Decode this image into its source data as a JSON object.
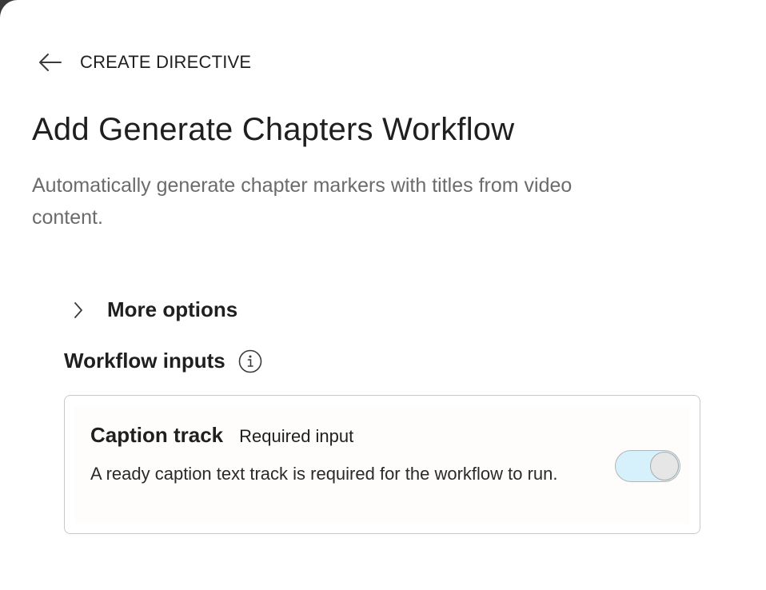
{
  "header": {
    "back_icon": "arrow-left-icon",
    "breadcrumb": "CREATE DIRECTIVE"
  },
  "page": {
    "title": "Add Generate Chapters Workflow",
    "subtitle": "Automatically generate chapter markers with titles from video content."
  },
  "more_options": {
    "icon": "chevron-right-icon",
    "label": "More options"
  },
  "workflow_inputs": {
    "label": "Workflow inputs",
    "info_icon": "info-icon",
    "items": [
      {
        "title": "Caption track",
        "badge": "Required input",
        "description": "A ready caption text track is required for the workflow to run.",
        "toggle_on": true
      }
    ]
  },
  "colors": {
    "toggle_track": "#d6f1fb",
    "subtitle_text": "#6b6b6b"
  }
}
